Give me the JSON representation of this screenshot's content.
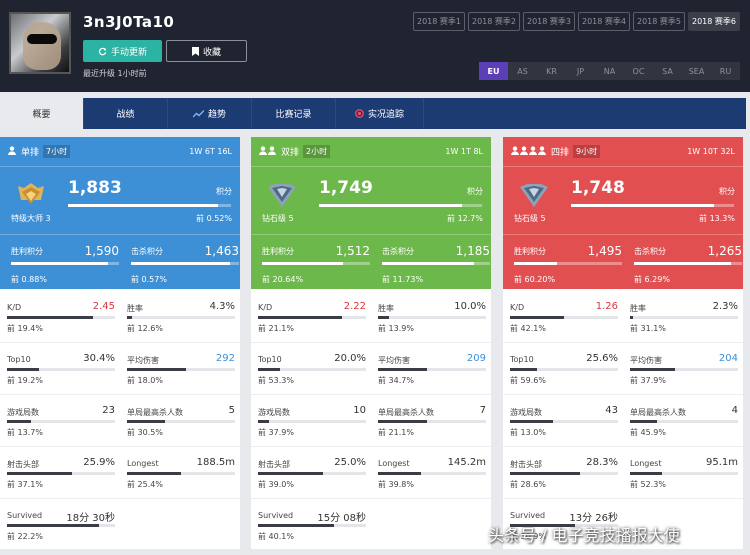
{
  "profile": {
    "username": "3n3J0Ta10",
    "update_label": "手动更新",
    "favorite_label": "收藏",
    "last_update": "最近升级 1小时前"
  },
  "seasons": [
    "2018 赛季1",
    "2018 赛季2",
    "2018 赛季3",
    "2018 赛季4",
    "2018 赛季5",
    "2018 赛季6"
  ],
  "active_season": "2018 赛季6",
  "regions": [
    "EU",
    "AS",
    "KR",
    "JP",
    "NA",
    "OC",
    "SA",
    "SEA",
    "RU"
  ],
  "active_region": "EU",
  "tabs": [
    {
      "label": "概要",
      "icon": ""
    },
    {
      "label": "战绩",
      "icon": ""
    },
    {
      "label": "趋势",
      "icon": "trend-icon"
    },
    {
      "label": "比赛记录",
      "icon": ""
    },
    {
      "label": "实况追踪",
      "icon": "live-icon"
    }
  ],
  "colors": {
    "solo": "#3d8fd6",
    "duo": "#6db84a",
    "squad": "#e24f51",
    "accent": "#5b3fb8",
    "update": "#2bb3a3"
  },
  "cards": [
    {
      "key": "solo",
      "icon": "person-icon",
      "name": "单排",
      "hours": "7小时",
      "record": "1W 6T 16L",
      "rank_icon": "master-rank-icon",
      "rank_name": "特级大师 3",
      "rating": "1,883",
      "rating_label": "积分",
      "rating_pct": "前 0.52%",
      "rating_fill": 0.92,
      "win_label": "胜利积分",
      "win_value": "1,590",
      "win_pct": "前 0.88%",
      "win_fill": 0.9,
      "kill_label": "击杀积分",
      "kill_value": "1,463",
      "kill_pct": "前 0.57%",
      "kill_fill": 0.92,
      "stats": [
        {
          "label": "K/D",
          "value": "2.45",
          "pct": "前 19.4%",
          "color": "red",
          "fill": 0.8
        },
        {
          "label": "胜率",
          "value": "4.3%",
          "pct": "前 12.6%",
          "color": "",
          "fill": 0.05
        },
        {
          "label": "Top10",
          "value": "30.4%",
          "pct": "前 19.2%",
          "color": "",
          "fill": 0.3
        },
        {
          "label": "平均伤害",
          "value": "292",
          "pct": "前 18.0%",
          "color": "blue",
          "fill": 0.55
        },
        {
          "label": "游戏局数",
          "value": "23",
          "pct": "前 13.7%",
          "color": "",
          "fill": 0.22
        },
        {
          "label": "单局最高杀人数",
          "value": "5",
          "pct": "前 30.5%",
          "color": "",
          "fill": 0.35
        },
        {
          "label": "射击头部",
          "value": "25.9%",
          "pct": "前 37.1%",
          "color": "",
          "fill": 0.6
        },
        {
          "label": "Longest",
          "value": "188.5m",
          "pct": "前 25.4%",
          "color": "",
          "fill": 0.5
        },
        {
          "label": "Survived",
          "value": "18分 30秒",
          "pct": "前 22.2%",
          "color": "",
          "fill": 0.85
        }
      ]
    },
    {
      "key": "duo",
      "icon": "duo-icon",
      "name": "双排",
      "hours": "2小时",
      "record": "1W 1T 8L",
      "rank_icon": "diamond-rank-icon",
      "rank_name": "钻石级 5",
      "rating": "1,749",
      "rating_label": "积分",
      "rating_pct": "前 12.7%",
      "rating_fill": 0.88,
      "win_label": "胜利积分",
      "win_value": "1,512",
      "win_pct": "前 20.64%",
      "win_fill": 0.75,
      "kill_label": "击杀积分",
      "kill_value": "1,185",
      "kill_pct": "前 11.73%",
      "kill_fill": 0.85,
      "stats": [
        {
          "label": "K/D",
          "value": "2.22",
          "pct": "前 21.1%",
          "color": "red",
          "fill": 0.78
        },
        {
          "label": "胜率",
          "value": "10.0%",
          "pct": "前 13.9%",
          "color": "",
          "fill": 0.1
        },
        {
          "label": "Top10",
          "value": "20.0%",
          "pct": "前 53.3%",
          "color": "",
          "fill": 0.2
        },
        {
          "label": "平均伤害",
          "value": "209",
          "pct": "前 34.7%",
          "color": "blue",
          "fill": 0.45
        },
        {
          "label": "游戏局数",
          "value": "10",
          "pct": "前 37.9%",
          "color": "",
          "fill": 0.1
        },
        {
          "label": "单局最高杀人数",
          "value": "7",
          "pct": "前 21.1%",
          "color": "",
          "fill": 0.45
        },
        {
          "label": "射击头部",
          "value": "25.0%",
          "pct": "前 39.0%",
          "color": "",
          "fill": 0.6
        },
        {
          "label": "Longest",
          "value": "145.2m",
          "pct": "前 39.8%",
          "color": "",
          "fill": 0.4
        },
        {
          "label": "Survived",
          "value": "15分 08秒",
          "pct": "前 40.1%",
          "color": "",
          "fill": 0.7
        }
      ]
    },
    {
      "key": "squad",
      "icon": "squad-icon",
      "name": "四排",
      "hours": "9小时",
      "record": "1W 10T 32L",
      "rank_icon": "diamond-rank-icon",
      "rank_name": "钻石级 5",
      "rating": "1,748",
      "rating_label": "积分",
      "rating_pct": "前 13.3%",
      "rating_fill": 0.88,
      "win_label": "胜利积分",
      "win_value": "1,495",
      "win_pct": "前 60.20%",
      "win_fill": 0.4,
      "kill_label": "击杀积分",
      "kill_value": "1,265",
      "kill_pct": "前 6.29%",
      "kill_fill": 0.9,
      "stats": [
        {
          "label": "K/D",
          "value": "1.26",
          "pct": "前 42.1%",
          "color": "red",
          "fill": 0.5
        },
        {
          "label": "胜率",
          "value": "2.3%",
          "pct": "前 31.1%",
          "color": "",
          "fill": 0.03
        },
        {
          "label": "Top10",
          "value": "25.6%",
          "pct": "前 59.6%",
          "color": "",
          "fill": 0.25
        },
        {
          "label": "平均伤害",
          "value": "204",
          "pct": "前 37.9%",
          "color": "blue",
          "fill": 0.42
        },
        {
          "label": "游戏局数",
          "value": "43",
          "pct": "前 13.0%",
          "color": "",
          "fill": 0.4
        },
        {
          "label": "单局最高杀人数",
          "value": "4",
          "pct": "前 45.9%",
          "color": "",
          "fill": 0.25
        },
        {
          "label": "射击头部",
          "value": "28.3%",
          "pct": "前 28.6%",
          "color": "",
          "fill": 0.65
        },
        {
          "label": "Longest",
          "value": "95.1m",
          "pct": "前 52.3%",
          "color": "",
          "fill": 0.3
        },
        {
          "label": "Survived",
          "value": "13分 26秒",
          "pct": "前 30.9%",
          "color": "",
          "fill": 0.6
        }
      ]
    }
  ],
  "watermark": "头条号 / 电子竞技播报大使"
}
